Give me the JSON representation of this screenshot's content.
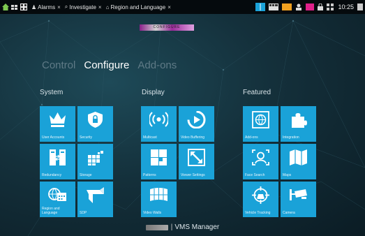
{
  "topbar": {
    "tabs": [
      {
        "label": "Alarms",
        "icon": "alarm-icon",
        "close": "×"
      },
      {
        "label": "Investigate",
        "icon": "investigate-icon",
        "close": "×"
      },
      {
        "label": "Region and Language",
        "icon": "region-icon",
        "close": "×"
      }
    ],
    "clock": "10:25"
  },
  "header_badge_text": "CONFIGURE",
  "mode_tabs": [
    "Control",
    "Configure",
    "Add-ons"
  ],
  "active_mode": "Configure",
  "sections": {
    "system": {
      "title": "System"
    },
    "display": {
      "title": "Display"
    },
    "featured": {
      "title": "Featured"
    }
  },
  "tiles": {
    "user_accounts": "User Accounts",
    "security": "Security",
    "redundancy": "Redundancy",
    "storage": "Storage",
    "region_language": "Region and Language",
    "sdp": "SDP",
    "multicast": "Multicast",
    "video_buffering": "Video Buffering",
    "patterns": "Patterns",
    "viewer_settings": "Viewer Settings",
    "video_walls": "Video Walls",
    "add_ons": "Add-ons",
    "integration": "Integration",
    "face_search": "Face Search",
    "maps": "Maps",
    "vehicle_tracking": "Vehicle Tracking",
    "camera": "Camera"
  },
  "footer": {
    "separator": "|",
    "app_name": "VMS Manager"
  },
  "colors": {
    "tile": "#1aa2d8",
    "topbar": "#050a0d",
    "bg": "#14303b"
  }
}
